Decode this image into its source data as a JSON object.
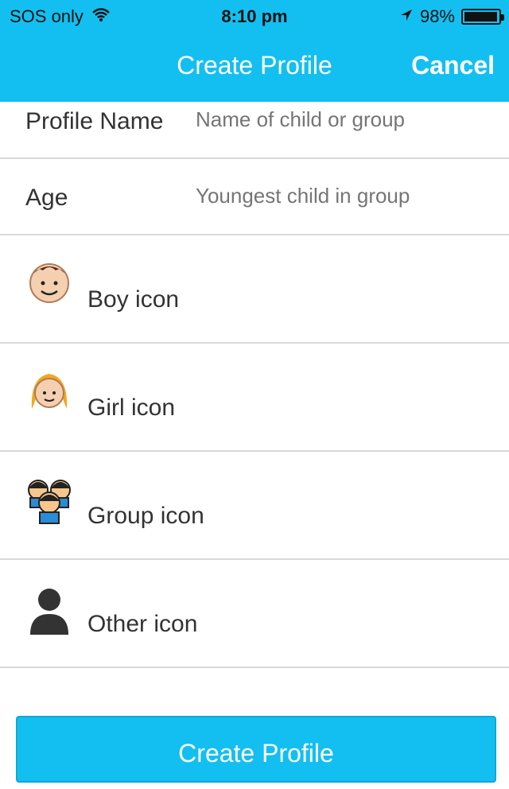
{
  "status": {
    "carrier": "SOS only",
    "time": "8:10 pm",
    "battery_text": "98%",
    "battery_level": 0.98
  },
  "nav": {
    "title": "Create Profile",
    "cancel": "Cancel"
  },
  "form": {
    "profile_name_label": "Profile Name",
    "profile_name_placeholder": "Name of child or group",
    "age_label": "Age",
    "age_placeholder": "Youngest child in group"
  },
  "icons": [
    {
      "label": "Boy icon",
      "icon": "boy-icon"
    },
    {
      "label": "Girl icon",
      "icon": "girl-icon"
    },
    {
      "label": "Group icon",
      "icon": "group-icon"
    },
    {
      "label": "Other icon",
      "icon": "person-silhouette-icon"
    }
  ],
  "button": {
    "create_profile": "Create Profile"
  },
  "colors": {
    "accent": "#13bff0"
  }
}
